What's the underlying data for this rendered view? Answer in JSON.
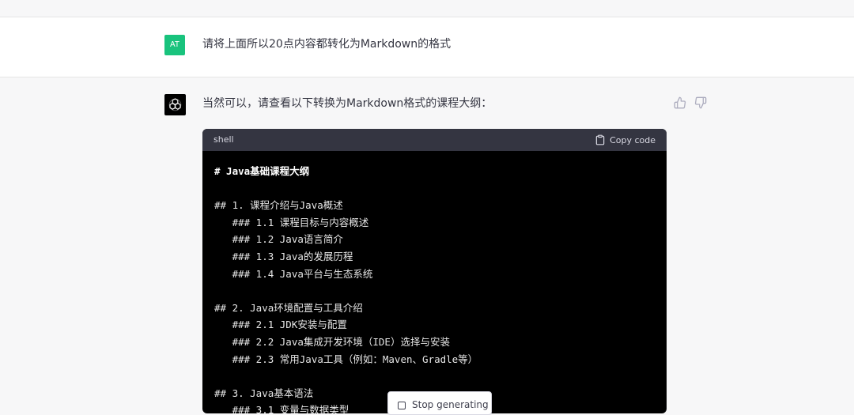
{
  "user_message": {
    "avatar_initials": "AT",
    "avatar_color": "#19c37d",
    "text": "请将上面所以20点内容都转化为Markdown的格式"
  },
  "assistant_message": {
    "avatar_icon": "openai-logo-icon",
    "intro": "当然可以，请查看以下转换为Markdown格式的课程大纲：",
    "feedback": {
      "thumbs_up_icon": "thumbs-up-icon",
      "thumbs_down_icon": "thumbs-down-icon"
    },
    "code_block": {
      "language": "shell",
      "copy_label": "Copy code",
      "lines": [
        "# Java基础课程大纲",
        "",
        "## 1. 课程介绍与Java概述",
        "   ### 1.1 课程目标与内容概述",
        "   ### 1.2 Java语言简介",
        "   ### 1.3 Java的发展历程",
        "   ### 1.4 Java平台与生态系统",
        "",
        "## 2. Java环境配置与工具介绍",
        "   ### 2.1 JDK安装与配置",
        "   ### 2.2 Java集成开发环境（IDE）选择与安装",
        "   ### 2.3 常用Java工具（例如：Maven、Gradle等）",
        "",
        "## 3. Java基本语法",
        "   ### 3.1 变量与数据类型"
      ]
    }
  },
  "stop_button": {
    "label": "Stop generating"
  }
}
